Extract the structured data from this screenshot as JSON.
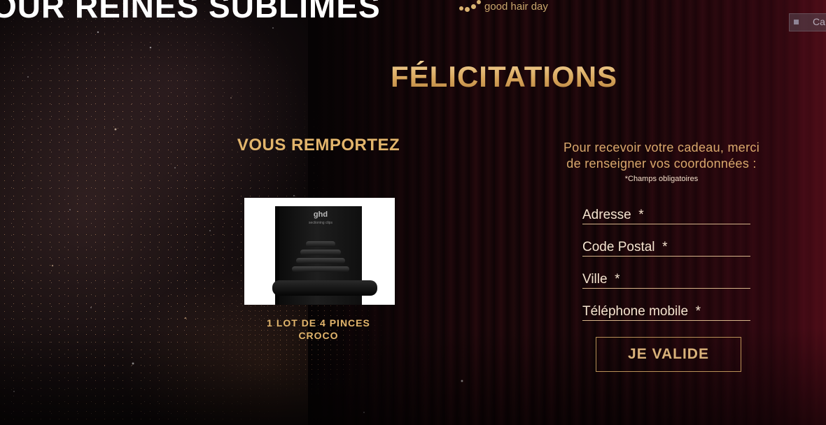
{
  "header": {
    "headline": "OUR REINES SUBLIMES",
    "brand": "good hair day",
    "corner_tab_label": "Ca"
  },
  "main": {
    "title": "FÉLICITATIONS",
    "win_heading": "VOUS REMPORTEZ",
    "prize": {
      "box_brand": "ghd",
      "box_label": "sectioning clips",
      "caption_line1": "1 LOT DE 4 PINCES",
      "caption_line2": "CROCO"
    }
  },
  "form": {
    "intro_line1": "Pour recevoir votre cadeau, merci",
    "intro_line2": "de renseigner vos coordonnées :",
    "required_note": "*Champs obligatoires",
    "fields": [
      {
        "placeholder": "Adresse  *",
        "value": ""
      },
      {
        "placeholder": "Code Postal  *",
        "value": ""
      },
      {
        "placeholder": "Ville  *",
        "value": ""
      },
      {
        "placeholder": "Téléphone mobile  *",
        "value": ""
      }
    ],
    "submit_label": "JE VALIDE"
  },
  "colors": {
    "gold": "#e2b56c",
    "field_text": "#f4e4cf",
    "background": "#050304"
  }
}
